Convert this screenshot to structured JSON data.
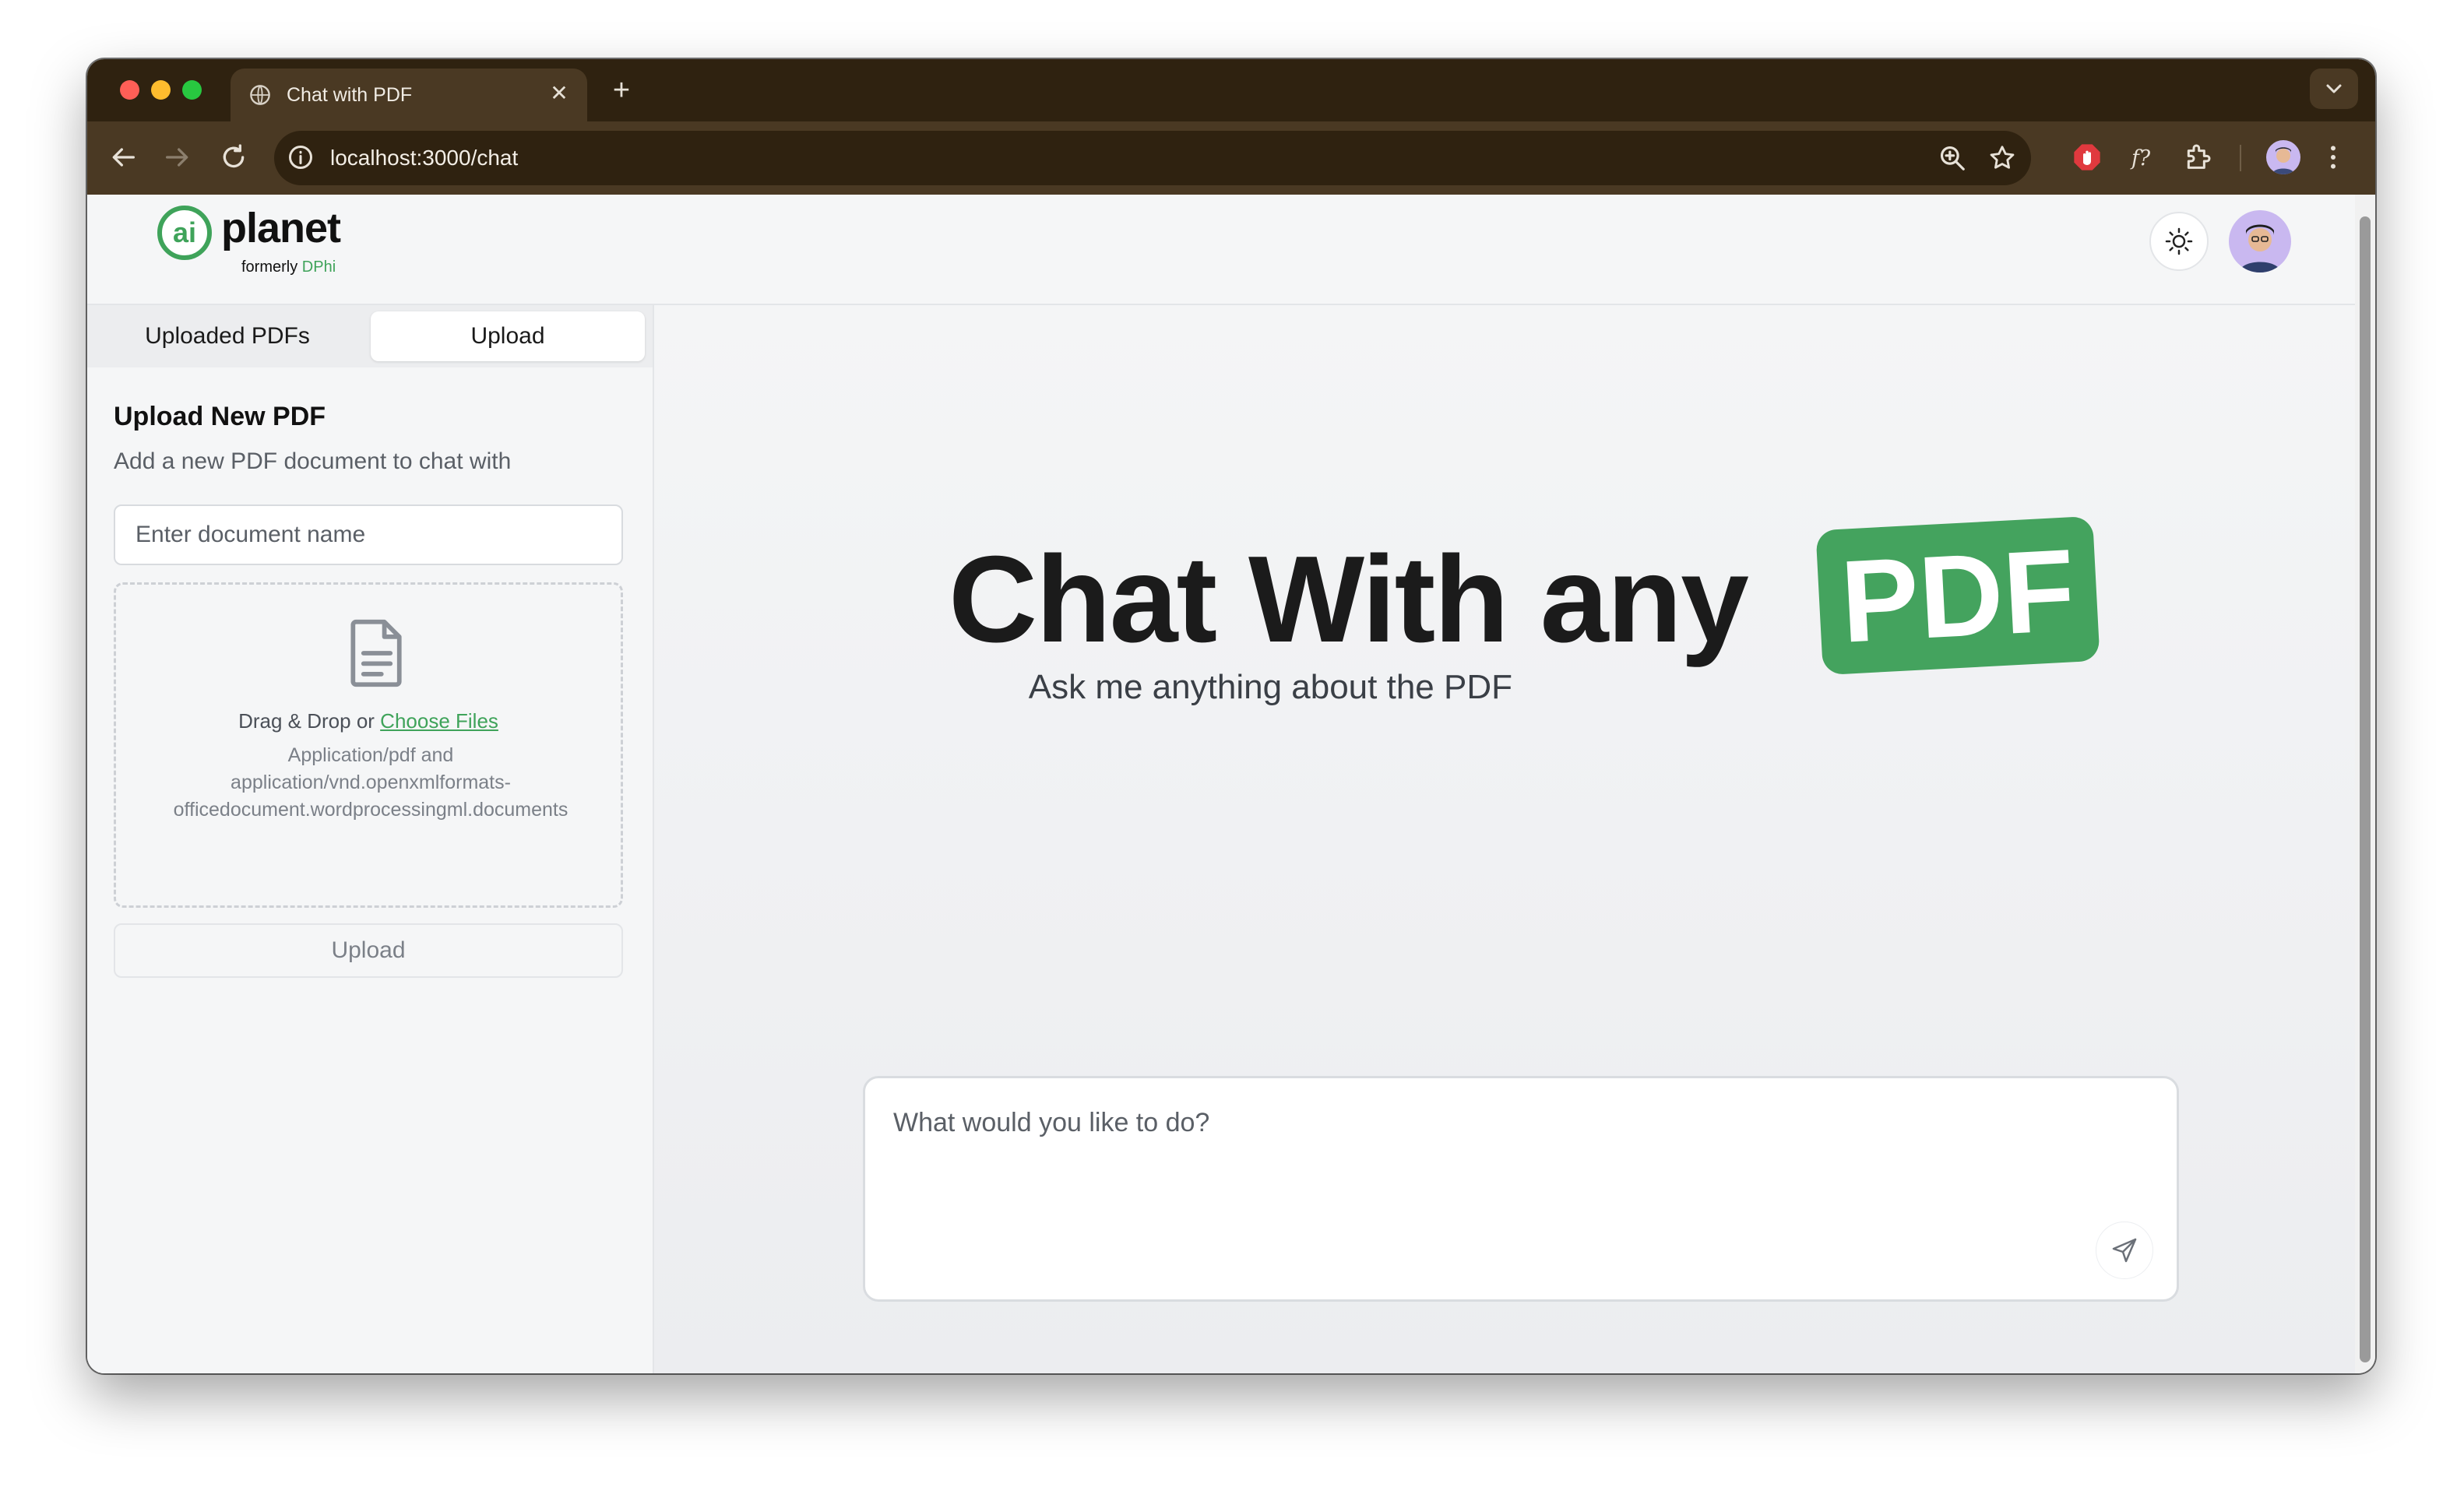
{
  "browser": {
    "tab_title": "Chat with PDF",
    "url": "localhost:3000/chat"
  },
  "header": {
    "logo_mark": "ai",
    "logo_word": "planet",
    "logo_sub_prefix": "formerly",
    "logo_sub_brand": "DPhi"
  },
  "sidebar": {
    "tabs": [
      {
        "label": "Uploaded PDFs",
        "active": false
      },
      {
        "label": "Upload",
        "active": true
      }
    ],
    "upload_title": "Upload New PDF",
    "upload_description": "Add a new PDF document to chat with",
    "doc_name_placeholder": "Enter document name",
    "doc_name_value": "",
    "dropzone_text": "Drag & Drop or",
    "dropzone_link": "Choose Files",
    "dropzone_types_1": "Application/pdf and",
    "dropzone_types_2": "application/vnd.openxmlformats-",
    "dropzone_types_3": "officedocument.wordprocessingml.documents",
    "upload_button": "Upload"
  },
  "main": {
    "hero_title": "Chat With any",
    "hero_badge": "PDF",
    "hero_subtitle": "Ask me anything about the PDF",
    "chat_placeholder": "What would you like to do?",
    "chat_value": ""
  },
  "colors": {
    "brand_green": "#44a35e",
    "chrome_dark": "#2f2210",
    "chrome_toolbar": "#4a3923"
  },
  "icons": {
    "tab_favicon": "globe-icon",
    "theme_toggle": "sun-icon",
    "send": "send-icon",
    "dropzone": "document-icon"
  }
}
